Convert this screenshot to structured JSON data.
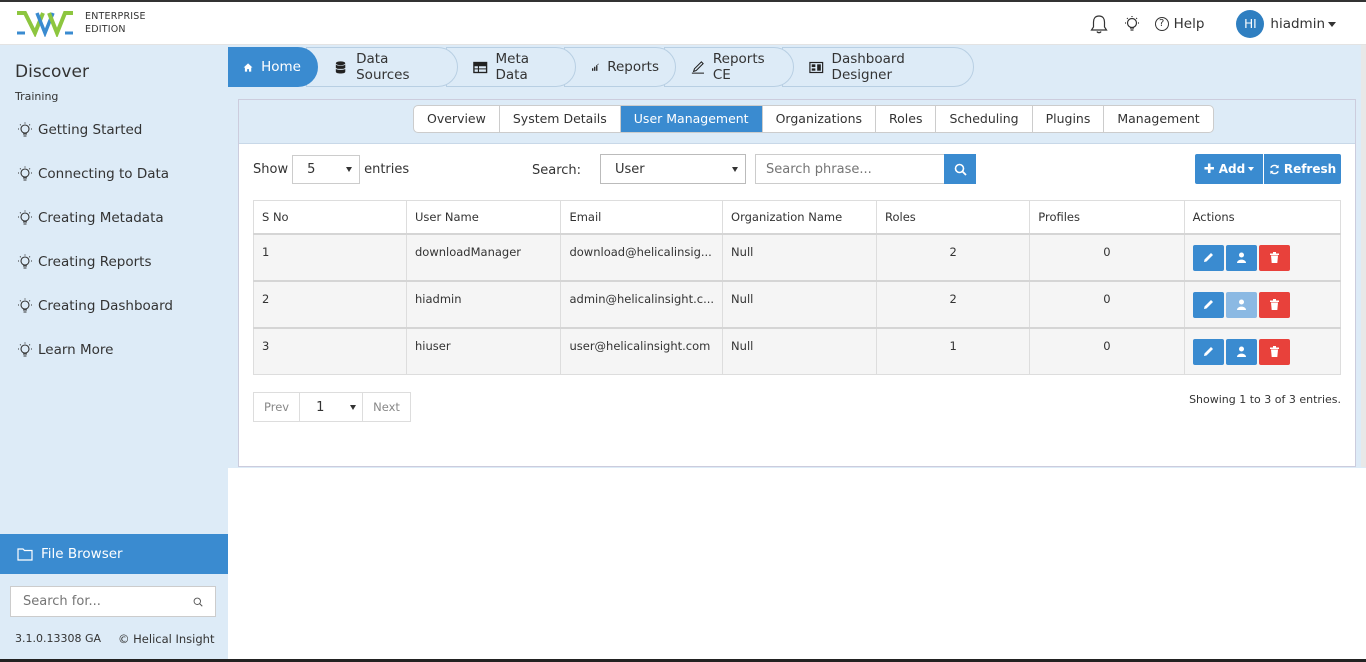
{
  "header": {
    "edition_line1": "ENTERPRISE",
    "edition_line2": "EDITION",
    "help": "Help",
    "avatar_initials": "HI",
    "username": "hiadmin"
  },
  "sidebar": {
    "title": "Discover",
    "subtitle": "Training",
    "items": [
      {
        "label": "Getting Started"
      },
      {
        "label": "Connecting to Data"
      },
      {
        "label": "Creating Metadata"
      },
      {
        "label": "Creating Reports"
      },
      {
        "label": "Creating Dashboard"
      },
      {
        "label": "Learn More"
      }
    ],
    "file_browser": "File Browser",
    "search_placeholder": "Search for...",
    "version": "3.1.0.13308 GA",
    "copyright": "© Helical Insight"
  },
  "tabs": [
    {
      "label": "Home",
      "icon": "home-icon"
    },
    {
      "label": "Data Sources",
      "icon": "database-icon"
    },
    {
      "label": "Meta Data",
      "icon": "table-icon"
    },
    {
      "label": "Reports",
      "icon": "bar-chart-icon"
    },
    {
      "label": "Reports CE",
      "icon": "pencil-icon"
    },
    {
      "label": "Dashboard Designer",
      "icon": "dashboard-icon"
    }
  ],
  "subtabs": [
    {
      "label": "Overview"
    },
    {
      "label": "System Details"
    },
    {
      "label": "User Management"
    },
    {
      "label": "Organizations"
    },
    {
      "label": "Roles"
    },
    {
      "label": "Scheduling"
    },
    {
      "label": "Plugins"
    },
    {
      "label": "Management"
    }
  ],
  "controls": {
    "show_label": "Show",
    "entries_value": "5",
    "entries_label": "entries",
    "search_label": "Search:",
    "search_by": "User",
    "phrase_placeholder": "Search phrase...",
    "add_label": "Add",
    "refresh_label": "Refresh"
  },
  "table": {
    "headers": [
      "S No",
      "User Name",
      "Email",
      "Organization Name",
      "Roles",
      "Profiles",
      "Actions"
    ],
    "rows": [
      {
        "sno": "1",
        "username": "downloadManager",
        "email": "download@helicalinsig...",
        "org": "Null",
        "roles": "2",
        "profiles": "0"
      },
      {
        "sno": "2",
        "username": "hiadmin",
        "email": "admin@helicalinsight.c...",
        "org": "Null",
        "roles": "2",
        "profiles": "0"
      },
      {
        "sno": "3",
        "username": "hiuser",
        "email": "user@helicalinsight.com",
        "org": "Null",
        "roles": "1",
        "profiles": "0"
      }
    ]
  },
  "pagination": {
    "prev": "Prev",
    "page": "1",
    "next": "Next",
    "showing": "Showing 1 to 3 of 3 entries."
  },
  "colors": {
    "accent": "#3a8bd0",
    "sidebar_bg": "#ddebf7",
    "delete": "#e8413b"
  }
}
